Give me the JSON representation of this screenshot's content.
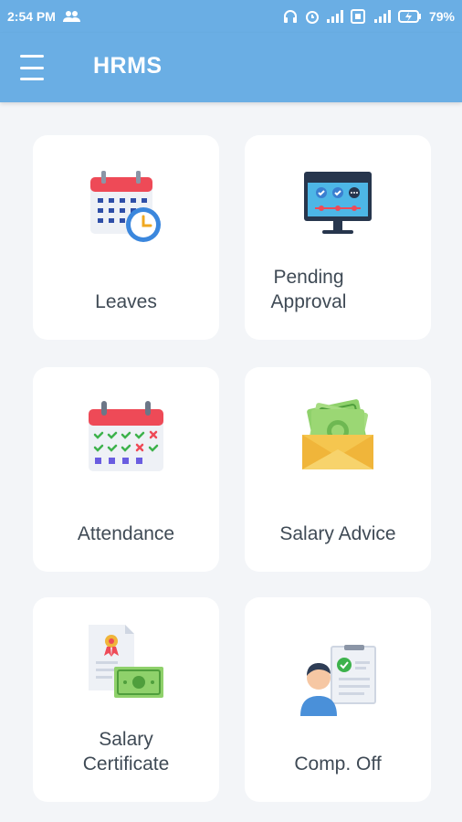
{
  "status_bar": {
    "time": "2:54 PM",
    "battery": "79%",
    "icons": [
      "people-icon",
      "headphones-icon",
      "alarm-icon",
      "signal-icon",
      "volte-icon",
      "signal-4g-icon",
      "battery-charging-icon"
    ]
  },
  "app_bar": {
    "title": "HRMS",
    "menu_icon": "hamburger-menu-icon"
  },
  "tiles": [
    {
      "label": "Leaves",
      "icon": "calendar-clock-icon"
    },
    {
      "label": "Pending Approval",
      "icon": "monitor-approval-icon"
    },
    {
      "label": "Attendance",
      "icon": "calendar-check-icon"
    },
    {
      "label": "Salary Advice",
      "icon": "money-envelope-icon"
    },
    {
      "label": "Salary Certificate",
      "icon": "certificate-money-icon"
    },
    {
      "label": "Comp. Off",
      "icon": "person-document-icon"
    }
  ],
  "colors": {
    "app_bar": "#6aaee4",
    "background": "#f3f5f8",
    "tile": "#ffffff",
    "label_text": "#3f4a55"
  }
}
